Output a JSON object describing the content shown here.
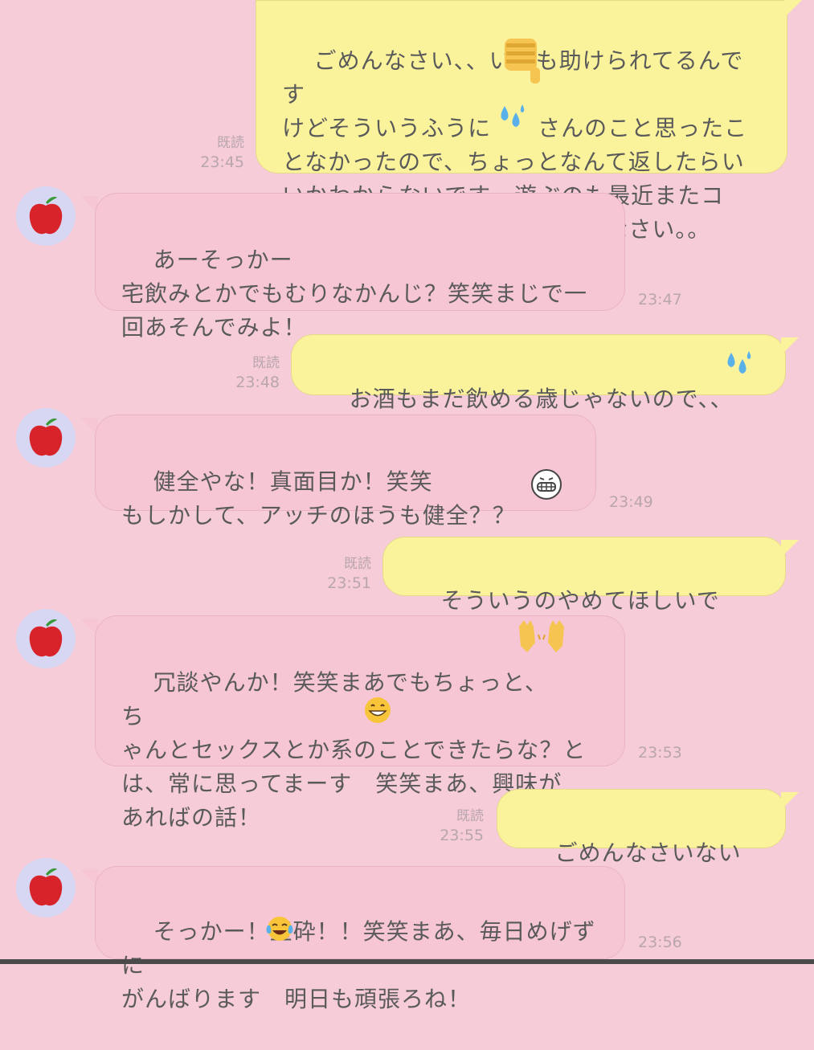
{
  "messages": [
    {
      "side": "sent",
      "read": "既読",
      "time": "23:45",
      "text": "ごめんなさい、、いつも助けられてるんです\nけどそういうふうに　　さんのこと思ったこ\nとなかったので、ちょっとなんて返したらい\nいかわからないです　遊ぶのも最近またコ\nロナ流行ってきてますしごめんなさい。。"
    },
    {
      "side": "recv",
      "time": "23:47",
      "text": "あーそっかー\n宅飲みとかでもむりなかんじ？笑笑まじで一\n回あそんでみよ！"
    },
    {
      "side": "sent",
      "read": "既読",
      "time": "23:48",
      "text": "お酒もまだ飲める歳じゃないので、、"
    },
    {
      "side": "recv",
      "time": "23:49",
      "text": "健全やな！真面目か！笑笑\nもしかして、アッチのほうも健全？？"
    },
    {
      "side": "sent",
      "read": "既読",
      "time": "23:51",
      "text": "そういうのやめてほしいです、、"
    },
    {
      "side": "recv",
      "time": "23:53",
      "text": "冗談やんか！笑笑まあでもちょっと、　　ち\nゃんとセックスとか系のことできたらな？と\nは、常に思ってまーす　笑笑まあ、興味が\nあればの話！"
    },
    {
      "side": "sent",
      "read": "既読",
      "time": "23:55",
      "text": "ごめんなさいないです"
    },
    {
      "side": "recv",
      "time": "23:56",
      "text": "そっかー！玉砕！！笑笑まあ、毎日めげずに\nがんばります　明日も頑張ろね！"
    }
  ],
  "avatar_icon": "apple-icon",
  "colors": {
    "background": "#f6ccd8",
    "sent_bubble": "#fbf39c",
    "recv_bubble": "#f6c6d4",
    "meta_text": "#b9a6ad"
  }
}
